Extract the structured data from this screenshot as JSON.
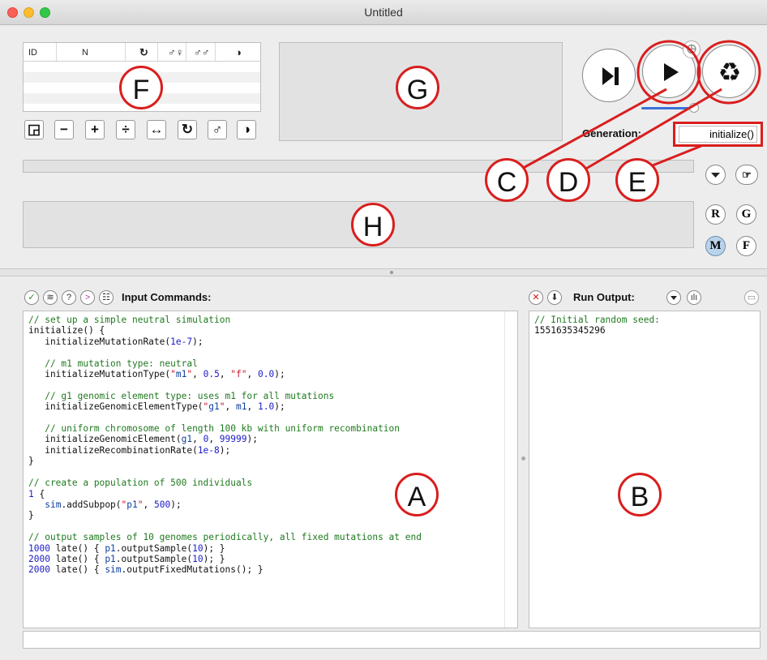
{
  "window": {
    "title": "Untitled"
  },
  "population_table": {
    "headers": [
      "ID",
      "N",
      "↻",
      "♂♀",
      "♂♂",
      "◑"
    ]
  },
  "toolbar_icons": [
    "new-subpop-icon",
    "remove-icon",
    "add-icon",
    "split-icon",
    "migrate-icon",
    "rotate-icon",
    "male-icon",
    "yin-yang-icon"
  ],
  "toolbar_glyphs": [
    "◲",
    "−",
    "+",
    "÷",
    "↔",
    "↻",
    "♂",
    "◑"
  ],
  "controls": {
    "generation_label": "Generation:",
    "generation_value": "initialize()",
    "side_buttons": [
      "R",
      "G",
      "M",
      "F"
    ]
  },
  "annotations": {
    "A": "A",
    "B": "B",
    "C": "C",
    "D": "D",
    "E": "E",
    "F": "F",
    "G": "G",
    "H": "H"
  },
  "input_panel": {
    "title": "Input Commands:"
  },
  "output_panel": {
    "title": "Run Output:",
    "lines": [
      "// Initial random seed:",
      "1551635345296"
    ]
  },
  "script_lines": [
    "// set up a simple neutral simulation",
    "initialize() {",
    "   initializeMutationRate(1e-7);",
    "",
    "   // m1 mutation type: neutral",
    "   initializeMutationType(\"m1\", 0.5, \"f\", 0.0);",
    "",
    "   // g1 genomic element type: uses m1 for all mutations",
    "   initializeGenomicElementType(\"g1\", m1, 1.0);",
    "",
    "   // uniform chromosome of length 100 kb with uniform recombination",
    "   initializeGenomicElement(g1, 0, 99999);",
    "   initializeRecombinationRate(1e-8);",
    "}",
    "",
    "// create a population of 500 individuals",
    "1 {",
    "   sim.addSubpop(\"p1\", 500);",
    "}",
    "",
    "// output samples of 10 genomes periodically, all fixed mutations at end",
    "1000 late() { p1.outputSample(10); }",
    "2000 late() { p1.outputSample(10); }",
    "2000 late() { sim.outputFixedMutations(); }"
  ],
  "colors": {
    "accent": "#d91e1e",
    "selected_button": "#b9d3ea"
  }
}
